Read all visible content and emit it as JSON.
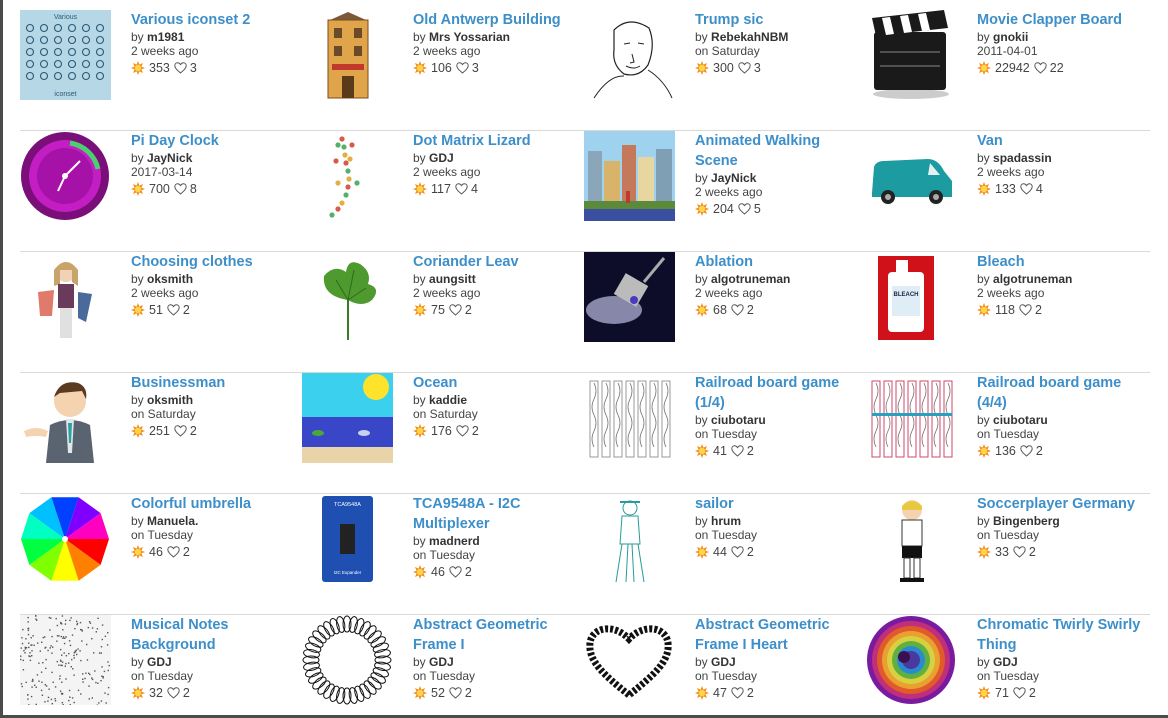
{
  "rows": [
    [
      {
        "title": "Various iconset 2",
        "by": "by",
        "author": "m1981",
        "date": "2 weeks ago",
        "downloads": "353",
        "likes": "3",
        "thumb": "iconset",
        "thumb_text_top": "Various",
        "thumb_text_bottom": "iconset"
      },
      {
        "title": "Old Antwerp Building",
        "by": "by",
        "author": "Mrs Yossarian",
        "date": "2 weeks ago",
        "downloads": "106",
        "likes": "3",
        "thumb": "building"
      },
      {
        "title": "Trump sic",
        "by": "by",
        "author": "RebekahNBM",
        "date": "on Saturday",
        "downloads": "300",
        "likes": "3",
        "thumb": "sketch"
      },
      {
        "title": "Movie Clapper Board",
        "by": "by",
        "author": "gnokii",
        "date": "2011-04-01",
        "downloads": "22942",
        "likes": "22",
        "thumb": "clapper"
      }
    ],
    [
      {
        "title": "Pi Day Clock",
        "by": "by",
        "author": "JayNick",
        "date": "2017-03-14",
        "downloads": "700",
        "likes": "8",
        "thumb": "clock"
      },
      {
        "title": "Dot Matrix Lizard",
        "by": "by",
        "author": "GDJ",
        "date": "2 weeks ago",
        "downloads": "117",
        "likes": "4",
        "thumb": "lizard"
      },
      {
        "title": "Animated Walking Scene",
        "by": "by",
        "author": "JayNick",
        "date": "2 weeks ago",
        "downloads": "204",
        "likes": "5",
        "thumb": "city"
      },
      {
        "title": "Van",
        "by": "by",
        "author": "spadassin",
        "date": "2 weeks ago",
        "downloads": "133",
        "likes": "4",
        "thumb": "van"
      }
    ],
    [
      {
        "title": "Choosing clothes",
        "by": "by",
        "author": "oksmith",
        "date": "2 weeks ago",
        "downloads": "51",
        "likes": "2",
        "thumb": "girl"
      },
      {
        "title": "Coriander Leav",
        "by": "by",
        "author": "aungsitt",
        "date": "2 weeks ago",
        "downloads": "75",
        "likes": "2",
        "thumb": "leaf"
      },
      {
        "title": "Ablation",
        "by": "by",
        "author": "algotruneman",
        "date": "2 weeks ago",
        "downloads": "68",
        "likes": "2",
        "thumb": "ablation"
      },
      {
        "title": "Bleach",
        "by": "by",
        "author": "algotruneman",
        "date": "2 weeks ago",
        "downloads": "118",
        "likes": "2",
        "thumb": "bleach",
        "thumb_text": "BLEACH"
      }
    ],
    [
      {
        "title": "Businessman",
        "by": "by",
        "author": "oksmith",
        "date": "on Saturday",
        "downloads": "251",
        "likes": "2",
        "thumb": "businessman"
      },
      {
        "title": "Ocean",
        "by": "by",
        "author": "kaddie",
        "date": "on Saturday",
        "downloads": "176",
        "likes": "2",
        "thumb": "ocean"
      },
      {
        "title": "Railroad board game (1/4)",
        "by": "by",
        "author": "ciubotaru",
        "date": "on Tuesday",
        "downloads": "41",
        "likes": "2",
        "thumb": "rail1"
      },
      {
        "title": "Railroad board game (4/4)",
        "by": "by",
        "author": "ciubotaru",
        "date": "on Tuesday",
        "downloads": "136",
        "likes": "2",
        "thumb": "rail4"
      }
    ],
    [
      {
        "title": "Colorful umbrella",
        "by": "by",
        "author": "Manuela.",
        "date": "on Tuesday",
        "downloads": "46",
        "likes": "2",
        "thumb": "umbrella"
      },
      {
        "title": "TCA9548A - I2C Multiplexer",
        "by": "by",
        "author": "madnerd",
        "date": "on Tuesday",
        "downloads": "46",
        "likes": "2",
        "thumb": "board",
        "thumb_text_top": "TCA9548A",
        "thumb_text_bottom": "I2C Expander"
      },
      {
        "title": "sailor",
        "by": "by",
        "author": "hrum",
        "date": "on Tuesday",
        "downloads": "44",
        "likes": "2",
        "thumb": "sailor"
      },
      {
        "title": "Soccerplayer Germany",
        "by": "by",
        "author": "Bingenberg",
        "date": "on Tuesday",
        "downloads": "33",
        "likes": "2",
        "thumb": "soccer"
      }
    ],
    [
      {
        "title": "Musical Notes Background",
        "by": "by",
        "author": "GDJ",
        "date": "on Tuesday",
        "downloads": "32",
        "likes": "2",
        "thumb": "noise"
      },
      {
        "title": "Abstract Geometric Frame I",
        "by": "by",
        "author": "GDJ",
        "date": "on Tuesday",
        "downloads": "52",
        "likes": "2",
        "thumb": "ring"
      },
      {
        "title": "Abstract Geometric Frame I Heart",
        "by": "by",
        "author": "GDJ",
        "date": "on Tuesday",
        "downloads": "47",
        "likes": "2",
        "thumb": "heart"
      },
      {
        "title": "Chromatic Twirly Swirly Thing",
        "by": "by",
        "author": "GDJ",
        "date": "on Tuesday",
        "downloads": "71",
        "likes": "2",
        "thumb": "swirl"
      }
    ]
  ],
  "icons": {
    "downloads": "sun-icon",
    "likes": "heart-outline-icon"
  },
  "colors": {
    "title_link": "#3d8fc9",
    "divider": "#d9d9d9",
    "download_icon": "#f28c1c"
  }
}
